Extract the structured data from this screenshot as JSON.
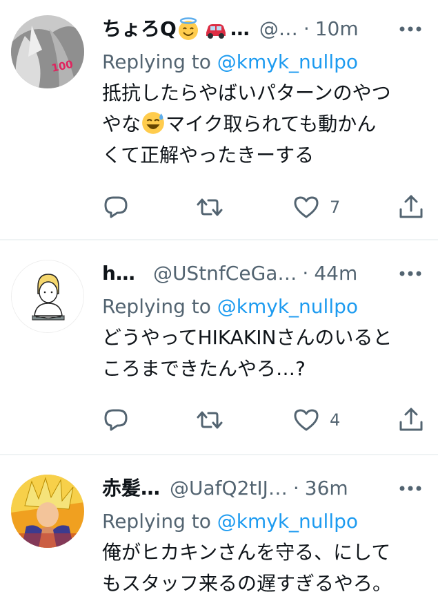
{
  "tweets": [
    {
      "name": "ちょろQ",
      "name_suffix": "…",
      "handle": "@…",
      "separator": "·",
      "time": "10m",
      "reply_prefix": "Replying to ",
      "reply_to": "@kmyk_nullpo",
      "text_lines": [
        "抵抗したらやばいパターンのやつ",
        "やな",
        "マイク取られても動かん",
        "くて正解やったきーする"
      ],
      "emojis": [
        "smiling-halo-emoji",
        "car-emoji",
        "sweat-smile-emoji"
      ],
      "like_count": "7",
      "avatar_badge": "100"
    },
    {
      "name": "h…",
      "handle": "@UStnfCeGa…",
      "separator": "·",
      "time": "44m",
      "reply_prefix": "Replying to ",
      "reply_to": "@kmyk_nullpo",
      "text_lines": [
        "どうやってHIKAKINさんのいると",
        "ころまできたんやろ…?"
      ],
      "like_count": "4"
    },
    {
      "name": "赤髪…",
      "handle": "@UafQ2tIJ…",
      "separator": "·",
      "time": "36m",
      "reply_prefix": "Replying to ",
      "reply_to": "@kmyk_nullpo",
      "text_lines": [
        "俺がヒカキンさんを守る、にして",
        "もスタッフ来るの遅すぎるやろ。"
      ]
    }
  ],
  "colors": {
    "accent": "#1d9bf0",
    "secondary": "#536471",
    "primary": "#0f1419",
    "divider": "#eff3f4"
  },
  "icons": [
    "more-icon",
    "reply-icon",
    "retweet-icon",
    "like-icon",
    "share-icon"
  ]
}
